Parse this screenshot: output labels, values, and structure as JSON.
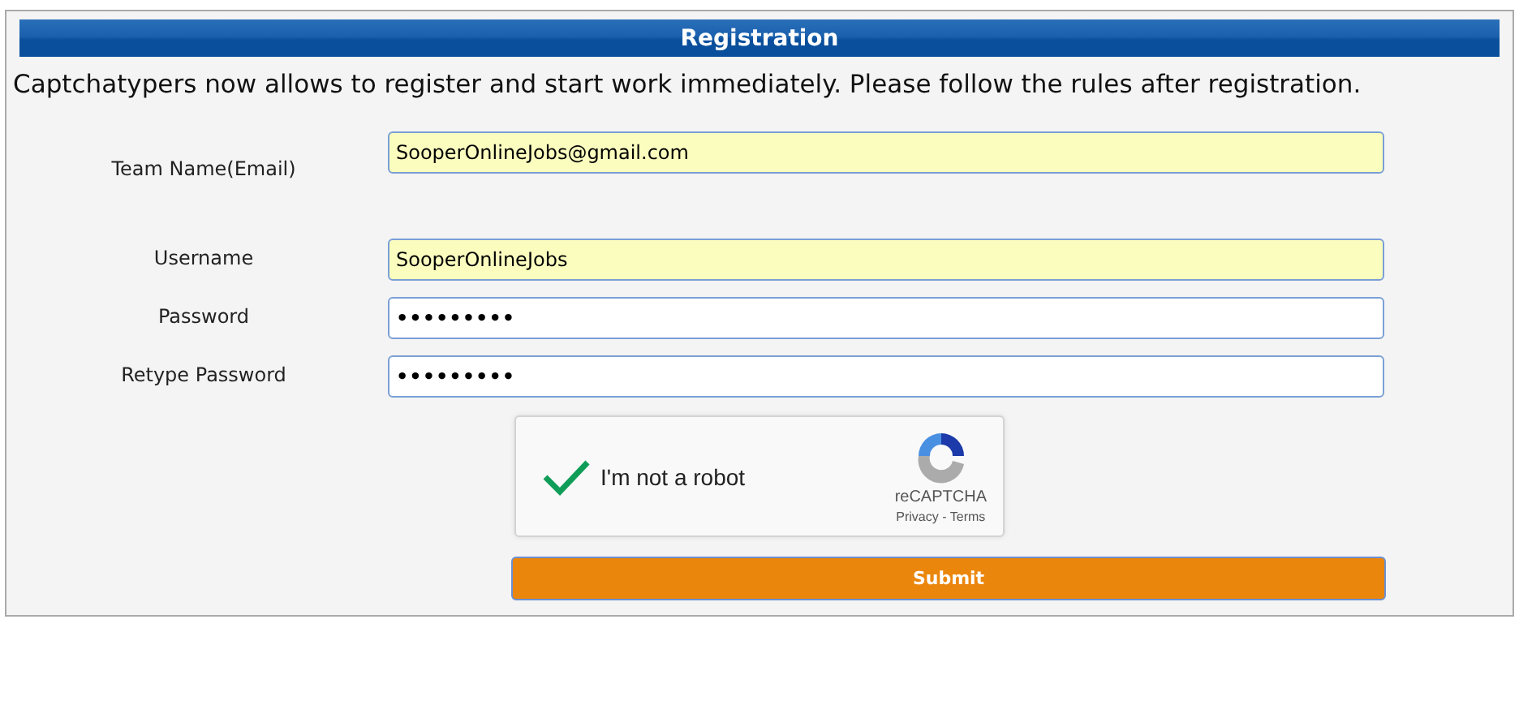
{
  "header": {
    "title": "Registration"
  },
  "intro": "Captchatypers now allows to register and start work immediately. Please follow the rules after registration.",
  "fields": [
    {
      "label": "Team Name(Email)",
      "kind": "text",
      "value": "SooperOnlineJobs@gmail.com",
      "autofilled": true
    },
    {
      "label": "Username",
      "kind": "text",
      "value": "SooperOnlineJobs",
      "autofilled": true
    },
    {
      "label": "Password",
      "kind": "password",
      "value": "•••••••••",
      "autofilled": false
    },
    {
      "label": "Retype Password",
      "kind": "password",
      "value": "•••••••••",
      "autofilled": false
    }
  ],
  "captcha": {
    "label": "I'm not a robot",
    "checked": true,
    "brand": "reCAPTCHA",
    "privacy": "Privacy",
    "separator": "-",
    "terms": "Terms"
  },
  "submit": "Submit"
}
